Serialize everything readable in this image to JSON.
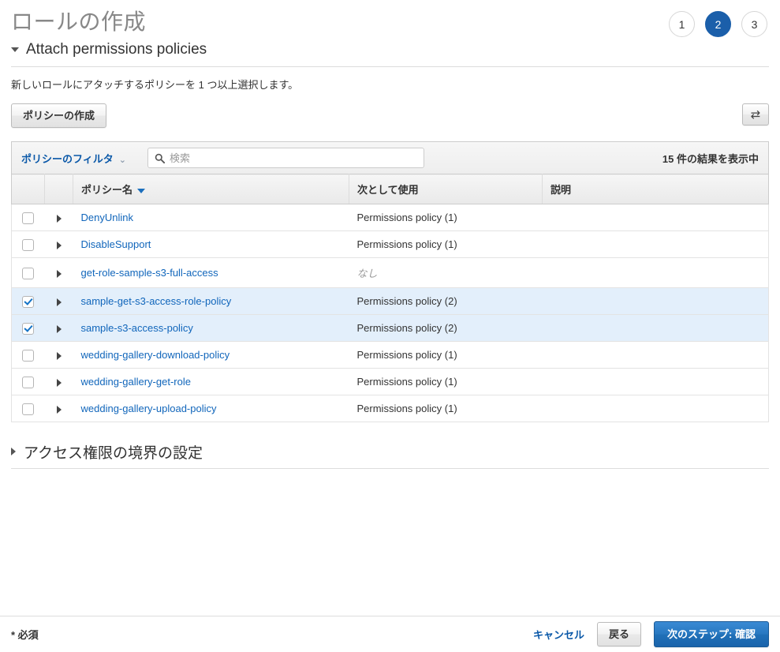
{
  "header": {
    "title": "ロールの作成",
    "steps": [
      {
        "label": "1",
        "active": false
      },
      {
        "label": "2",
        "active": true
      },
      {
        "label": "3",
        "active": false
      }
    ]
  },
  "permissions_section": {
    "title": "Attach permissions policies",
    "description": "新しいロールにアタッチするポリシーを 1 つ以上選択します。",
    "expanded": true
  },
  "toolbar": {
    "create_policy_label": "ポリシーの作成",
    "refresh_icon": "refresh-icon"
  },
  "filter_bar": {
    "filter_label": "ポリシーのフィルタ",
    "filter_caret": "⌄",
    "search_icon": "search-icon",
    "search_placeholder": "検索",
    "search_value": "",
    "result_count": "15 件の結果を表示中"
  },
  "table": {
    "columns": {
      "checkbox": "",
      "expand": "",
      "name": "ポリシー名",
      "used_as": "次として使用",
      "description": "説明"
    },
    "sort_column": "name",
    "sort_direction": "desc",
    "rows": [
      {
        "checked": false,
        "name": "DenyUnlink",
        "used_as": "Permissions policy (1)",
        "used_as_muted": false,
        "description": ""
      },
      {
        "checked": false,
        "name": "DisableSupport",
        "used_as": "Permissions policy (1)",
        "used_as_muted": false,
        "description": ""
      },
      {
        "checked": false,
        "name": "get-role-sample-s3-full-access",
        "used_as": "なし",
        "used_as_muted": true,
        "description": ""
      },
      {
        "checked": true,
        "name": "sample-get-s3-access-role-policy",
        "used_as": "Permissions policy (2)",
        "used_as_muted": false,
        "description": ""
      },
      {
        "checked": true,
        "name": "sample-s3-access-policy",
        "used_as": "Permissions policy (2)",
        "used_as_muted": false,
        "description": ""
      },
      {
        "checked": false,
        "name": "wedding-gallery-download-policy",
        "used_as": "Permissions policy (1)",
        "used_as_muted": false,
        "description": ""
      },
      {
        "checked": false,
        "name": "wedding-gallery-get-role",
        "used_as": "Permissions policy (1)",
        "used_as_muted": false,
        "description": ""
      },
      {
        "checked": false,
        "name": "wedding-gallery-upload-policy",
        "used_as": "Permissions policy (1)",
        "used_as_muted": false,
        "description": ""
      }
    ]
  },
  "boundary_section": {
    "title": "アクセス権限の境界の設定",
    "expanded": false
  },
  "footer": {
    "required_note": "* 必須",
    "cancel_label": "キャンセル",
    "back_label": "戻る",
    "next_label": "次のステップ: 確認"
  },
  "colors": {
    "accent_blue": "#1b5faa",
    "link_blue": "#1166bb",
    "selected_row": "#e3effb",
    "primary_button": "#2878c0",
    "title_gray": "#888888"
  }
}
